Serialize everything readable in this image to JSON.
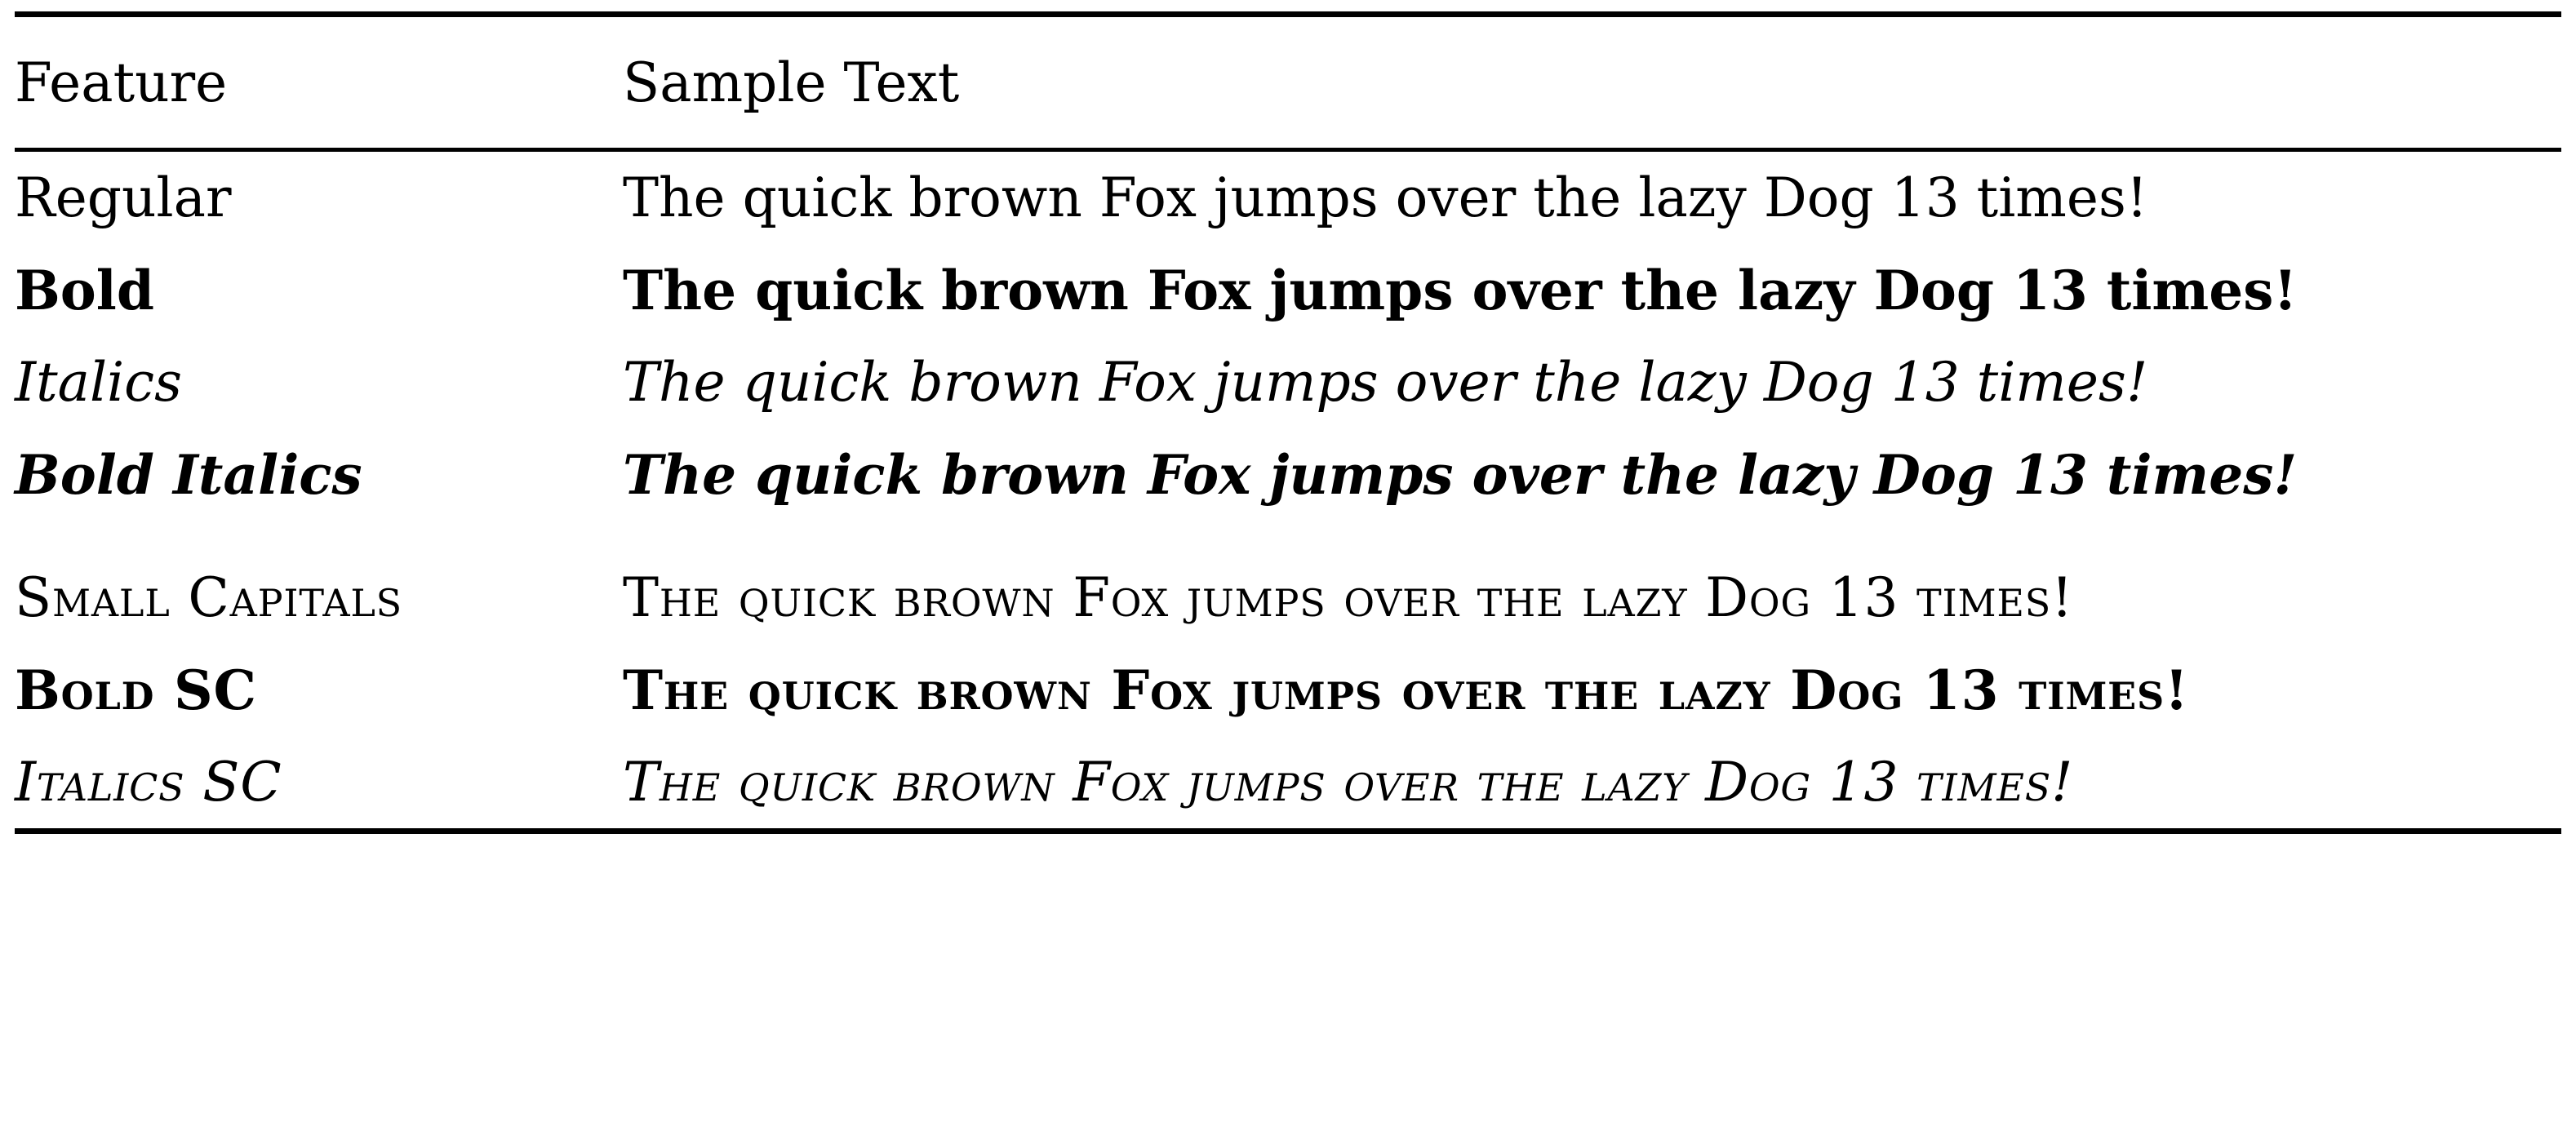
{
  "table": {
    "columns": [
      {
        "key": "feature",
        "header": "Feature"
      },
      {
        "key": "sample",
        "header": "Sample Text"
      }
    ],
    "rows": [
      {
        "feature": "Regular",
        "sample": "The quick brown Fox jumps over the lazy Dog 13 times!",
        "variant": "regular",
        "group": 1
      },
      {
        "feature": "Bold",
        "sample": "The quick brown Fox jumps over the lazy Dog 13 times!",
        "variant": "bold",
        "group": 1
      },
      {
        "feature": "Italics",
        "sample": "The quick brown Fox jumps over the lazy Dog 13 times!",
        "variant": "italic",
        "group": 1
      },
      {
        "feature": "Bold Italics",
        "sample": "The quick brown Fox jumps over the lazy Dog 13 times!",
        "variant": "bolditalic",
        "group": 1
      },
      {
        "feature": "Small Capitals",
        "sample": "The quick brown Fox jumps over the lazy Dog 13 times!",
        "variant": "smallcaps",
        "group": 2
      },
      {
        "feature": "Bold SC",
        "sample": "The quick brown Fox jumps over the lazy Dog 13 times!",
        "variant": "boldsc",
        "group": 2
      },
      {
        "feature": "Italics SC",
        "sample": "The quick brown Fox jumps over the lazy Dog 13 times!",
        "variant": "italicsc",
        "group": 2
      }
    ]
  },
  "rules": {
    "top": "toprule",
    "mid": "midrule",
    "bottom": "bottomrule"
  },
  "colors": {
    "text": "#000000",
    "background": "#ffffff",
    "rule": "#000000"
  }
}
